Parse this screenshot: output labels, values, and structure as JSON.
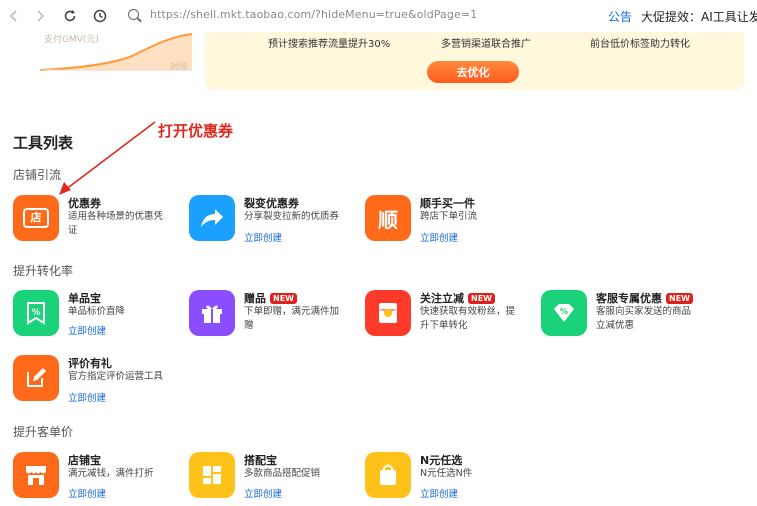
{
  "browser": {
    "url": "https://shell.mkt.taobao.com/?hideMenu=true&oldPage=1",
    "notice": "公告",
    "promo": "大促提效：AI工具让发品"
  },
  "banner": {
    "gmv_label": "支付GMV(元)",
    "time_label": "时间",
    "features": [
      "预计搜索推荐流量提升30%",
      "多营销渠道联合推广",
      "前台低价标签助力转化"
    ],
    "optimize_label": "去优化"
  },
  "annotation": "打开优惠券",
  "section_title": "工具列表",
  "groups": [
    {
      "title": "店铺引流",
      "tools": [
        {
          "name": "优惠券",
          "desc": "适用各种场景的优惠凭证",
          "create": "",
          "badge": ""
        },
        {
          "name": "裂变优惠券",
          "desc": "分享裂变拉新的优质券",
          "create": "立即创建",
          "badge": ""
        },
        {
          "name": "顺手买一件",
          "desc": "跨店下单引流",
          "create": "立即创建",
          "badge": ""
        }
      ]
    },
    {
      "title": "提升转化率",
      "tools": [
        {
          "name": "单品宝",
          "desc": "单品标价直降",
          "create": "立即创建",
          "badge": ""
        },
        {
          "name": "赠品",
          "desc": "下单即赠，满元满件加赠",
          "create": "立即创建",
          "badge": "NEW"
        },
        {
          "name": "关注立减",
          "desc": "快速获取有效粉丝，提升下单转化",
          "create": "立即创建",
          "badge": "NEW"
        },
        {
          "name": "客服专属优惠",
          "desc": "客服向买家发送的商品立减优惠",
          "create": "立即创建",
          "badge": "NEW"
        },
        {
          "name": "评价有礼",
          "desc": "官方指定评价运营工具",
          "create": "立即创建",
          "badge": ""
        }
      ]
    },
    {
      "title": "提升客单价",
      "tools": [
        {
          "name": "店铺宝",
          "desc": "满元减钱，满件打折",
          "create": "立即创建",
          "badge": ""
        },
        {
          "name": "搭配宝",
          "desc": "多款商品搭配促销",
          "create": "立即创建",
          "badge": ""
        },
        {
          "name": "N元任选",
          "desc": "N元任选N件",
          "create": "立即创建",
          "badge": ""
        }
      ]
    }
  ],
  "icon_glyphs": {
    "coupon": "店",
    "shunshou": "顺"
  },
  "colors": {
    "orange": "#ff6a1a",
    "blue": "#1aa0ff",
    "green": "#19d27a",
    "purple": "#8a4dff",
    "red": "#ff3a2a",
    "yellow": "#ffc21a",
    "link": "#1668dc",
    "badge": "#e0201a"
  }
}
